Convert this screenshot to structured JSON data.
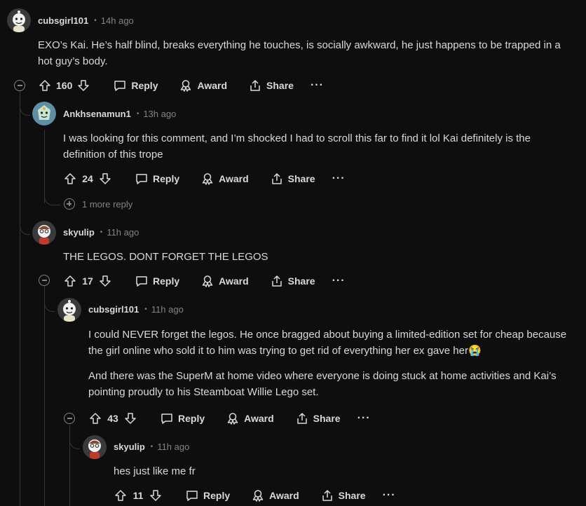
{
  "comments": [
    {
      "author": "cubsgirl101",
      "time": "14h ago",
      "paragraphs": [
        "EXO’s Kai. He’s half blind, breaks everything he touches, is socially awkward, he just happens to be trapped in a hot guy’s body."
      ],
      "score": "160"
    },
    {
      "author": "Ankhsenamun1",
      "time": "13h ago",
      "paragraphs": [
        "I was looking for this comment, and I’m shocked I had to scroll this far to find it lol Kai definitely is the definition of this trope"
      ],
      "score": "24",
      "more_replies": "1 more reply"
    },
    {
      "author": "skyulip",
      "time": "11h ago",
      "paragraphs": [
        "THE LEGOS. DONT FORGET THE LEGOS"
      ],
      "score": "17"
    },
    {
      "author": "cubsgirl101",
      "time": "11h ago",
      "paragraphs": [
        "I could NEVER forget the legos. He once bragged about buying a limited-edition set for cheap because the girl online who sold it to him was trying to get rid of everything her ex gave her😭",
        "And there was the SuperM at home video where everyone is doing stuck at home activities and Kai’s pointing proudly to his Steamboat Willie Lego set."
      ],
      "score": "43"
    },
    {
      "author": "skyulip",
      "time": "11h ago",
      "paragraphs": [
        "hes just like me fr"
      ],
      "score": "11"
    }
  ],
  "labels": {
    "reply": "Reply",
    "award": "Award",
    "share": "Share",
    "more": "···",
    "dot": "•"
  },
  "colors": {
    "background": "#0e0e0f",
    "text": "#d7dadc",
    "muted": "#818384",
    "thread": "#343536"
  }
}
